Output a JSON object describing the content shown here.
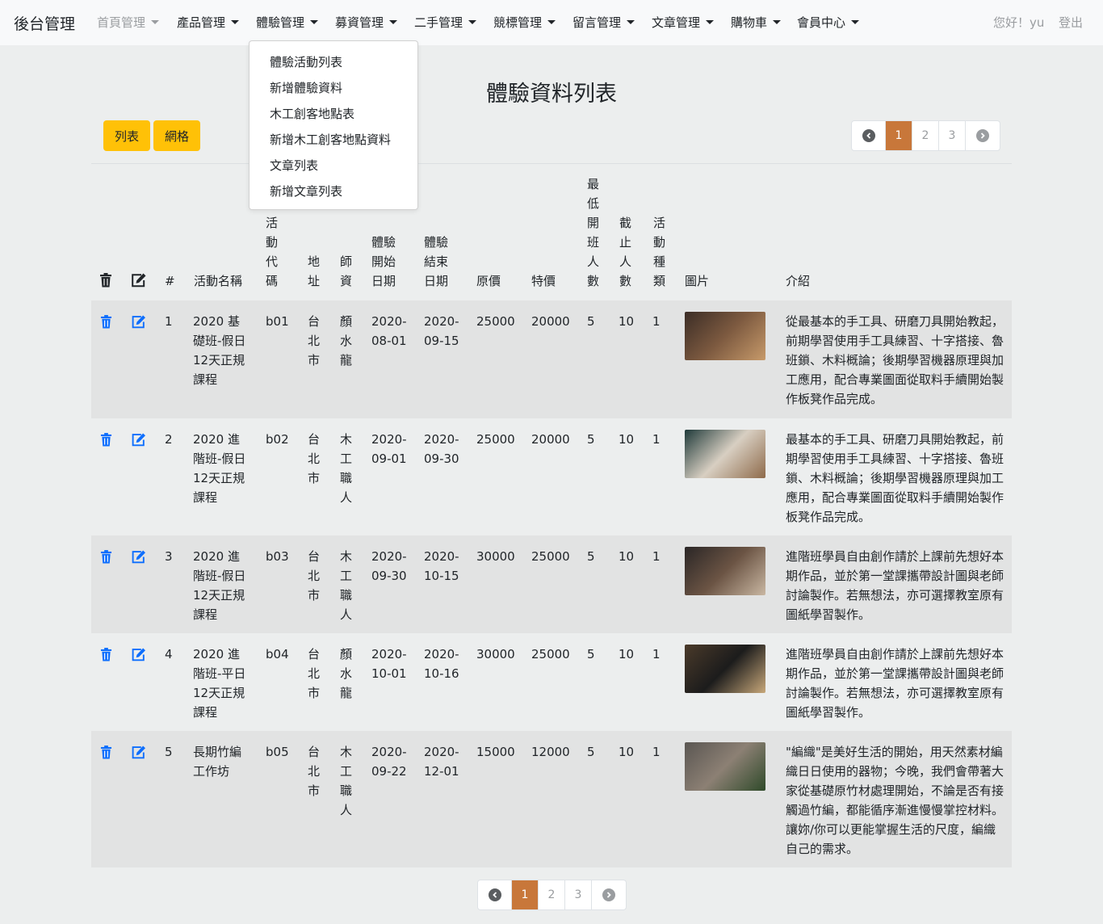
{
  "navbar": {
    "brand": "後台管理",
    "menus": [
      {
        "label": "首頁管理",
        "muted": true
      },
      {
        "label": "產品管理"
      },
      {
        "label": "體驗管理"
      },
      {
        "label": "募資管理"
      },
      {
        "label": "二手管理"
      },
      {
        "label": "競標管理"
      },
      {
        "label": "留言管理"
      },
      {
        "label": "文章管理"
      },
      {
        "label": "購物車"
      },
      {
        "label": "會員中心"
      }
    ],
    "greeting": "您好！yu",
    "logout": "登出"
  },
  "dropdown": {
    "items": [
      "體驗活動列表",
      "新增體驗資料",
      "木工創客地點表",
      "新增木工創客地點資料",
      "文章列表",
      "新增文章列表"
    ]
  },
  "page": {
    "title": "體驗資料列表",
    "view_list": "列表",
    "view_grid": "網格"
  },
  "pagination": {
    "pages": [
      "1",
      "2",
      "3"
    ],
    "active": "1"
  },
  "table": {
    "headers": {
      "num": "#",
      "name": "活動名稱",
      "code": "活動代碼",
      "address": "地址",
      "teacher": "師資",
      "start": "體驗開始日期",
      "end": "體驗結束日期",
      "price": "原價",
      "special": "特價",
      "min": "最低開班人數",
      "max": "截止人數",
      "type": "活動種類",
      "image": "圖片",
      "intro": "介紹"
    },
    "rows": [
      {
        "num": "1",
        "name": "2020 基礎班-假日 12天正規課程",
        "code": "b01",
        "address": "台北市",
        "teacher": "顏水龍",
        "start": "2020-08-01",
        "end": "2020-09-15",
        "price": "25000",
        "special": "20000",
        "min": "5",
        "max": "10",
        "type": "1",
        "intro": "從最基本的手工具、研磨刀具開始教起，前期學習使用手工具練習、十字搭接、魯班鎖、木料概論；後期學習機器原理與加工應用，配合專業圖面從取料手續開始製作板凳作品完成。"
      },
      {
        "num": "2",
        "name": "2020 進階班-假日 12天正規課程",
        "code": "b02",
        "address": "台北市",
        "teacher": "木工職人",
        "start": "2020-09-01",
        "end": "2020-09-30",
        "price": "25000",
        "special": "20000",
        "min": "5",
        "max": "10",
        "type": "1",
        "intro": "最基本的手工具、研磨刀具開始教起，前期學習使用手工具練習、十字搭接、魯班鎖、木料概論；後期學習機器原理與加工應用，配合專業圖面從取料手續開始製作板凳作品完成。"
      },
      {
        "num": "3",
        "name": "2020 進階班-假日 12天正規課程",
        "code": "b03",
        "address": "台北市",
        "teacher": "木工職人",
        "start": "2020-09-30",
        "end": "2020-10-15",
        "price": "30000",
        "special": "25000",
        "min": "5",
        "max": "10",
        "type": "1",
        "intro": "進階班學員自由創作請於上課前先想好本期作品，並於第一堂課攜帶設計圖與老師討論製作。若無想法，亦可選擇教室原有圖紙學習製作。"
      },
      {
        "num": "4",
        "name": "2020 進階班-平日 12天正規課程",
        "code": "b04",
        "address": "台北市",
        "teacher": "顏水龍",
        "start": "2020-10-01",
        "end": "2020-10-16",
        "price": "30000",
        "special": "25000",
        "min": "5",
        "max": "10",
        "type": "1",
        "intro": "進階班學員自由創作請於上課前先想好本期作品，並於第一堂課攜帶設計圖與老師討論製作。若無想法，亦可選擇教室原有圖紙學習製作。"
      },
      {
        "num": "5",
        "name": "長期竹編工作坊",
        "code": "b05",
        "address": "台北市",
        "teacher": "木工職人",
        "start": "2020-09-22",
        "end": "2020-12-01",
        "price": "15000",
        "special": "12000",
        "min": "5",
        "max": "10",
        "type": "1",
        "intro": "\"編織\"是美好生活的開始，用天然素材編織日日使用的器物；今晚，我們會帶著大家從基礎原竹材處理開始，不論是否有接觸過竹編，都能循序漸進慢慢掌控材料。讓妳/你可以更能掌握生活的尺度，編織自己的需求。"
      }
    ]
  },
  "colors": {
    "accent": "#c8773a",
    "button": "#ffc107",
    "icon": "#0d6efd"
  }
}
